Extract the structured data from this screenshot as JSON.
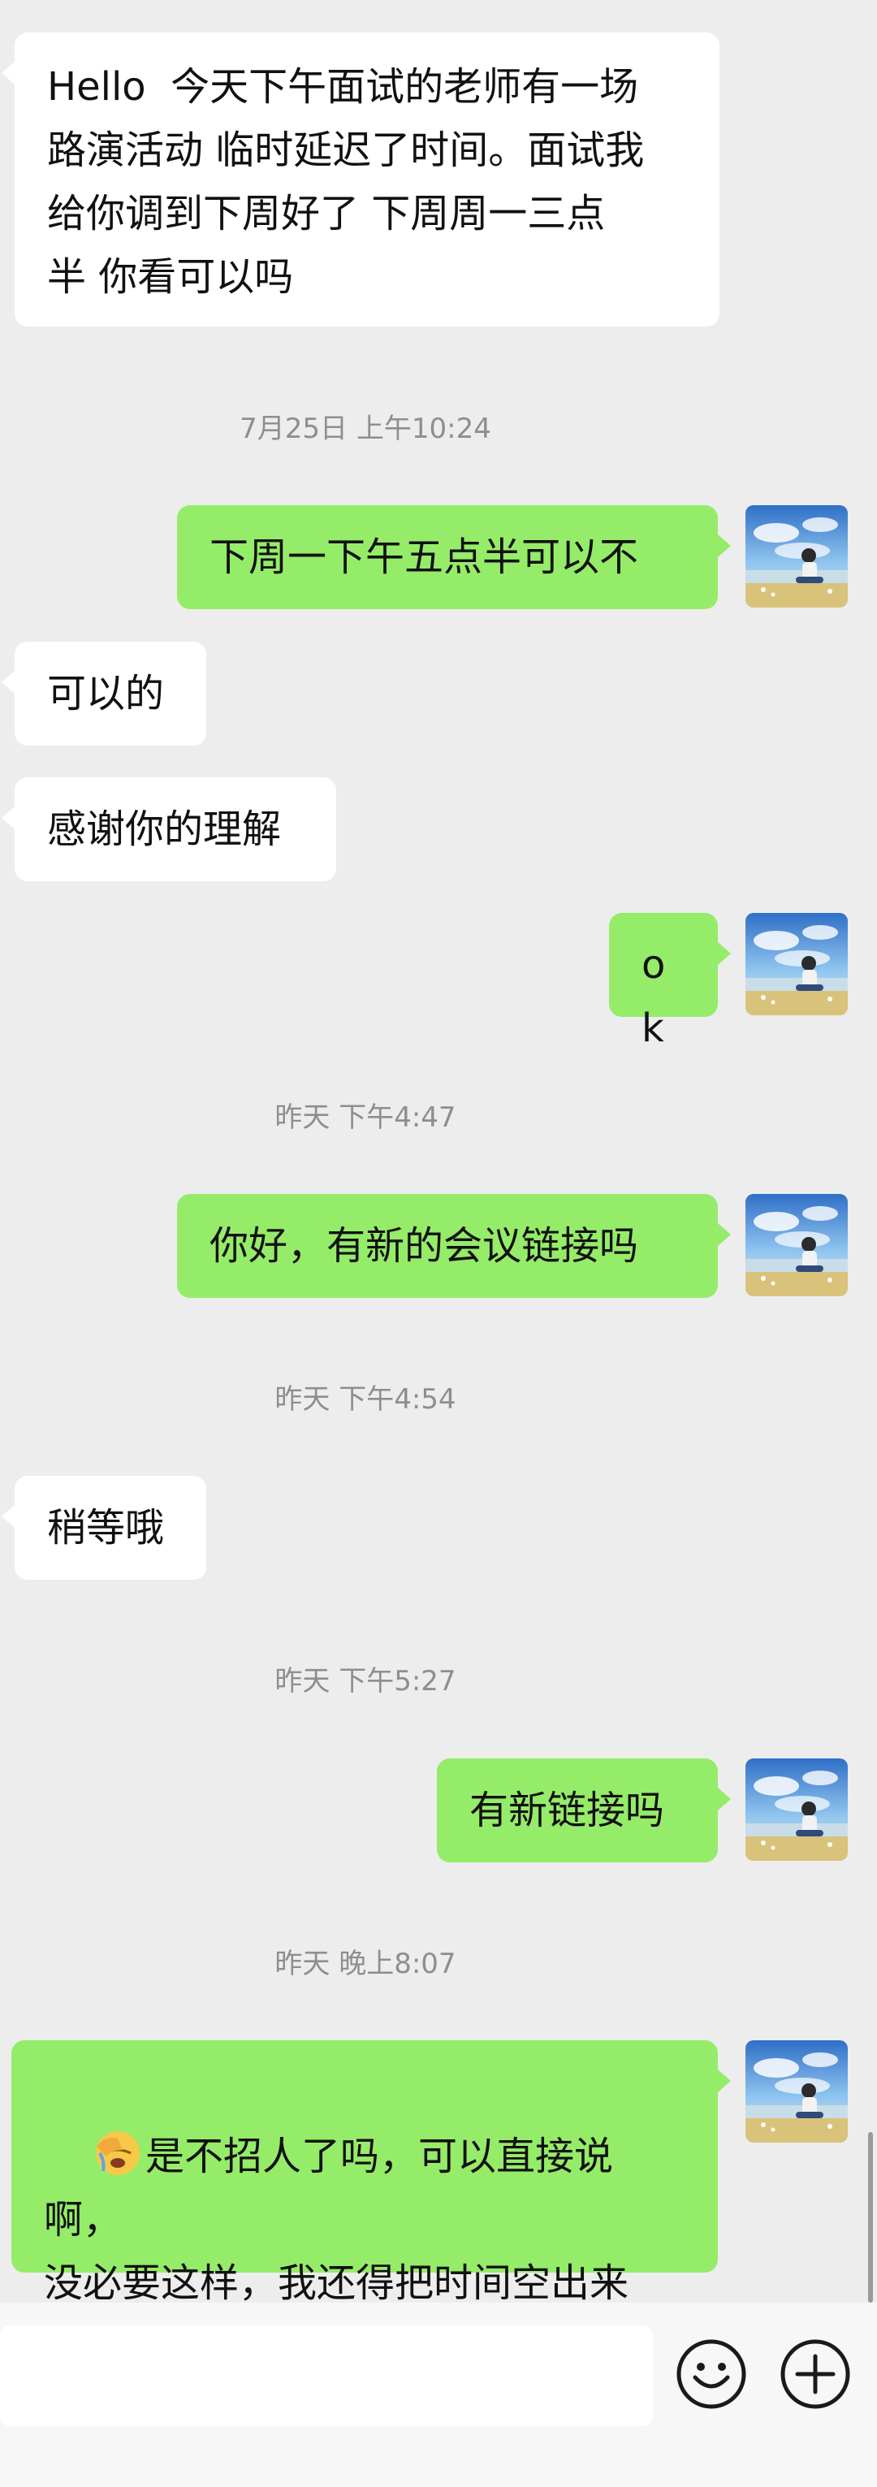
{
  "messages": {
    "m1": "Hello  今天下午面试的老师有一场\n路演活动 临时延迟了时间。面试我\n给你调到下周好了 下周周一三点\n半 你看可以吗",
    "m2": "下周一下午五点半可以不",
    "m3": "可以的",
    "m4": "感谢你的理解",
    "m5": "ok",
    "m6": "你好，有新的会议链接吗",
    "m7": "稍等哦",
    "m8": "有新链接吗",
    "m9": "是不招人了吗，可以直接说啊，\n没必要这样，我还得把时间空出来\n等你们"
  },
  "timestamps": {
    "t1": "7月25日 上午10:24",
    "t2": "昨天 下午4:47",
    "t3": "昨天 下午4:54",
    "t4": "昨天 下午5:27",
    "t5": "昨天 晚上8:07"
  },
  "colors": {
    "chat_bg": "#ededed",
    "incoming_bubble": "#ffffff",
    "outgoing_bubble": "#95ec69",
    "timestamp_text": "#8e8e8e"
  },
  "icons": {
    "emoji_button": "smiley-face-icon",
    "more_button": "plus-circle-icon",
    "inline_emoji": "face-palm-emoji"
  }
}
